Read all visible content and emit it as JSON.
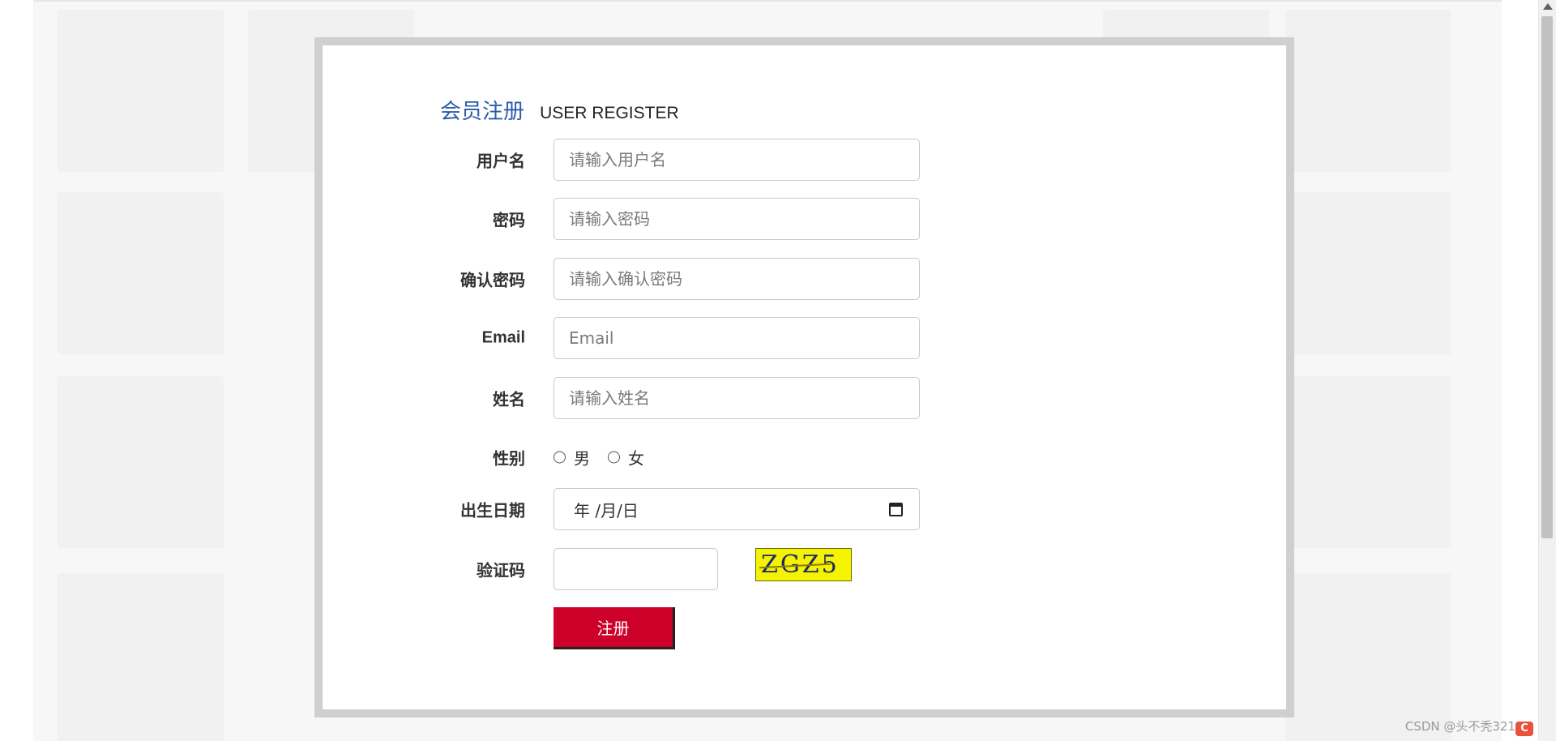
{
  "form": {
    "title_cn": "会员注册",
    "title_en": "USER REGISTER",
    "username": {
      "label": "用户名",
      "placeholder": "请输入用户名"
    },
    "password": {
      "label": "密码",
      "placeholder": "请输入密码"
    },
    "confirm_password": {
      "label": "确认密码",
      "placeholder": "请输入确认密码"
    },
    "email": {
      "label": "Email",
      "placeholder": "Email"
    },
    "name": {
      "label": "姓名",
      "placeholder": "请输入姓名"
    },
    "gender": {
      "label": "性别",
      "options": [
        "男",
        "女"
      ]
    },
    "birthdate": {
      "label": "出生日期",
      "display": "年 /月/日"
    },
    "captcha": {
      "label": "验证码",
      "image_text": "ZGZ5"
    },
    "submit_label": "注册"
  },
  "watermark": "CSDN @头不秃321",
  "colors": {
    "title_blue": "#2a5caa",
    "button_red": "#cc0028",
    "captcha_yellow": "#f5f300"
  },
  "icons": {
    "calendar": "calendar-icon",
    "scroll_up": "chevron-up-icon"
  }
}
